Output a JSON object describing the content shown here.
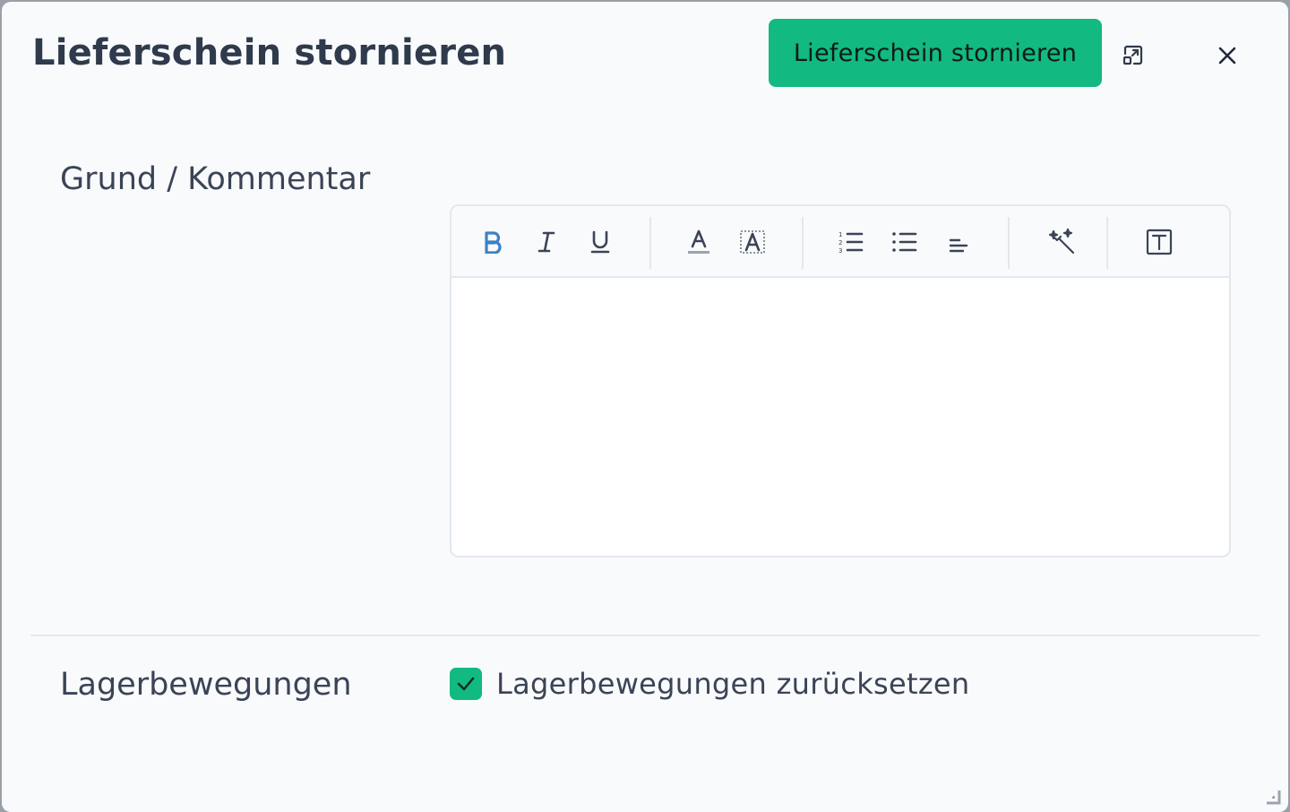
{
  "dialog": {
    "title": "Lieferschein stornieren",
    "primary_button_label": "Lieferschein stornieren",
    "expand_icon": "expand-icon",
    "close_icon": "close-icon"
  },
  "form": {
    "comment_label": "Grund / Kommentar",
    "editor": {
      "toolbar_icons": [
        "bold-icon",
        "italic-icon",
        "underline-icon",
        "text-color-icon",
        "highlight-icon",
        "ordered-list-icon",
        "bullet-list-icon",
        "align-icon",
        "magic-wand-icon",
        "text-block-icon"
      ],
      "content": ""
    },
    "stock_label": "Lagerbewegungen",
    "reset_stock_checkbox": {
      "label": "Lagerbewegungen zurücksetzen",
      "checked": true
    }
  },
  "colors": {
    "accent": "#12b981",
    "bold_active": "#3b82c4",
    "text": "#3b4456"
  }
}
